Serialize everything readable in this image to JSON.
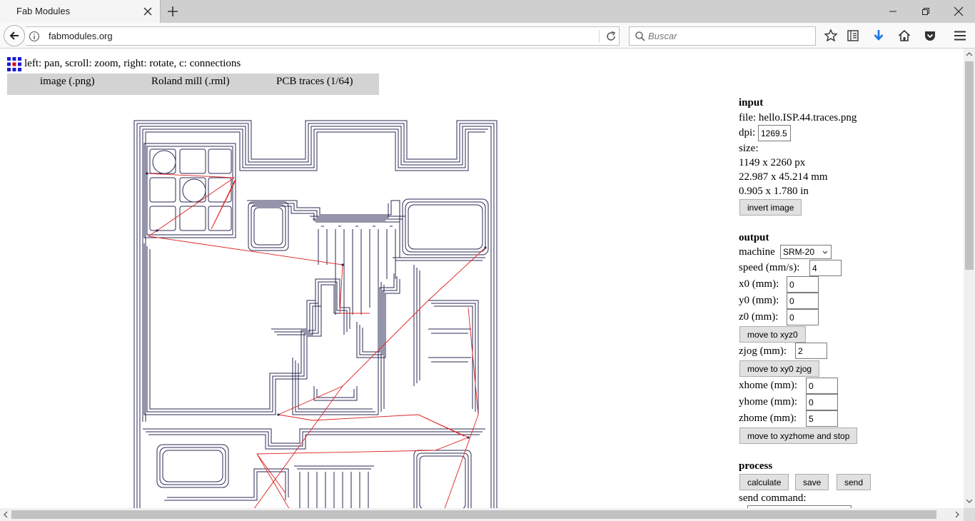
{
  "browser": {
    "tab_title": "Fab Modules",
    "url": "fabmodules.org",
    "search_placeholder": "Buscar"
  },
  "page": {
    "hint": "left: pan, scroll: zoom, right: rotate, c: connections",
    "menu": [
      "image (.png)",
      "Roland mill (.rml)",
      "PCB traces (1/64)"
    ]
  },
  "input": {
    "heading": "input",
    "file_label": "file: hello.ISP.44.traces.png",
    "dpi_label": "dpi:",
    "dpi_value": "1269.5",
    "size_label": "size:",
    "size_px": "1149 x 2260 px",
    "size_mm": "22.987 x 45.214 mm",
    "size_in": "0.905 x 1.780 in",
    "invert_button": "invert image"
  },
  "output": {
    "heading": "output",
    "machine_label": "machine",
    "machine_value": "SRM-20",
    "speed_label": "speed (mm/s):",
    "speed_value": "4",
    "x0_label": "x0 (mm):",
    "x0_value": "0",
    "y0_label": "y0 (mm):",
    "y0_value": "0",
    "z0_label": "z0 (mm):",
    "z0_value": "0",
    "move_xyz0_button": "move to xyz0",
    "zjog_label": "zjog (mm):",
    "zjog_value": "2",
    "move_zjog_button": "move to xy0 zjog",
    "xhome_label": "xhome (mm):",
    "xhome_value": "0",
    "yhome_label": "yhome (mm):",
    "yhome_value": "0",
    "zhome_label": "zhome (mm):",
    "zhome_value": "5",
    "move_home_button": "move to xyzhome and stop"
  },
  "process": {
    "heading": "process",
    "calculate_button": "calculate",
    "save_button": "save",
    "send_button": "send",
    "send_command_label": "send command:"
  },
  "colors": {
    "trace": "#2a2a55",
    "connection": "#e02020",
    "menubar": "#d3d3d3",
    "download_arrow": "#1a73e8"
  }
}
